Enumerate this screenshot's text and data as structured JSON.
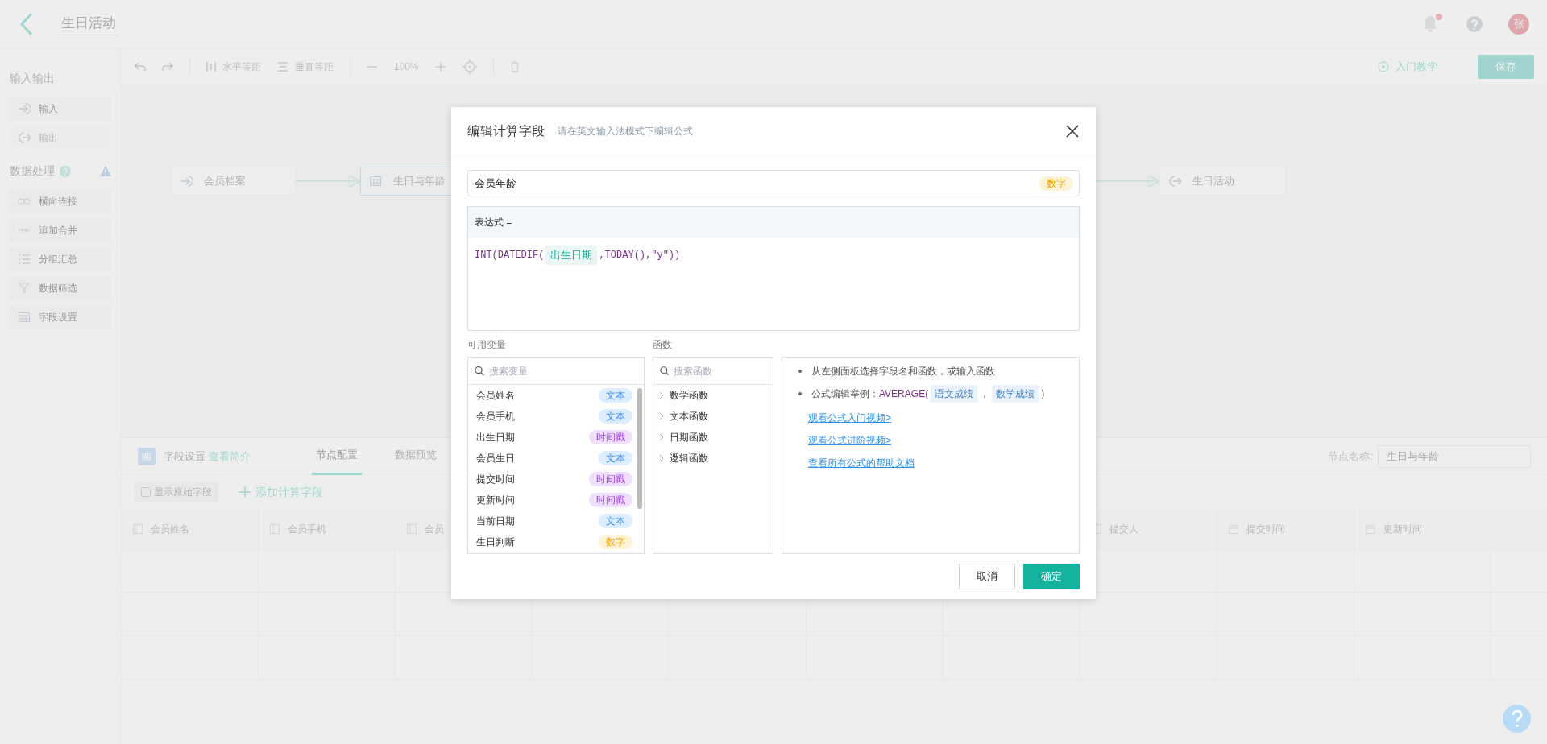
{
  "header": {
    "title": "生日活动",
    "has_notification": true,
    "avatar": "张"
  },
  "sidebar": {
    "sections": [
      {
        "title": "输入输出",
        "items": [
          {
            "label": "输入",
            "kind": "input",
            "disabled": false
          },
          {
            "label": "输出",
            "kind": "output",
            "disabled": true
          }
        ]
      },
      {
        "title": "数据处理",
        "help": true,
        "warning": true,
        "items": [
          {
            "label": "横向连接",
            "kind": "join",
            "disabled": false
          },
          {
            "label": "追加合并",
            "kind": "append",
            "disabled": false
          },
          {
            "label": "分组汇总",
            "kind": "group",
            "disabled": false
          },
          {
            "label": "数据筛选",
            "kind": "filter",
            "disabled": false
          },
          {
            "label": "字段设置",
            "kind": "fields",
            "disabled": false
          }
        ]
      }
    ]
  },
  "toolbar": {
    "h_distribute": "水平等距",
    "v_distribute": "垂直等距",
    "zoom": "100%",
    "tutorial": "入门教学",
    "save": "保存"
  },
  "canvas": {
    "nodes": [
      {
        "label": "会员档案",
        "kind": "input",
        "selected": false
      },
      {
        "label": "生日与年龄",
        "kind": "fields",
        "selected": true
      },
      {
        "label": "生日活动",
        "kind": "output",
        "selected": false
      }
    ]
  },
  "panel": {
    "title": "字段设置",
    "intro_link": "查看简介",
    "tabs": [
      {
        "label": "节点配置",
        "selected": true
      },
      {
        "label": "数据预览",
        "selected": false
      }
    ],
    "node_name_label": "节点名称:",
    "node_name": "生日与年龄",
    "show_original": "显示原始字段",
    "add_field": "添加计算字段",
    "table": {
      "columns_left": [
        {
          "label": "会员姓名",
          "kind": "text"
        },
        {
          "label": "会员手机",
          "kind": "text"
        },
        {
          "label": "会员",
          "kind": "text"
        }
      ],
      "columns_right": [
        {
          "label": "提交人",
          "kind": "text"
        },
        {
          "label": "提交时间",
          "kind": "date"
        },
        {
          "label": "更新时间",
          "kind": "date"
        }
      ]
    }
  },
  "modal": {
    "title": "编辑计算字段",
    "hint": "请在英文输入法模式下编辑公式",
    "field_name": "会员年龄",
    "field_type": {
      "label": "数字",
      "kind": "number"
    },
    "expression_label": "表达式 =",
    "expression": [
      {
        "kind": "code",
        "text": "INT(DATEDIF("
      },
      {
        "kind": "field",
        "text": "出生日期"
      },
      {
        "kind": "code",
        "text": ",TODAY(),\"y\"))"
      }
    ],
    "variables_label": "可用变量",
    "variables_search": {
      "placeholder": "搜索变量"
    },
    "variables": [
      {
        "name": "会员姓名",
        "type": {
          "label": "文本",
          "kind": "text"
        }
      },
      {
        "name": "会员手机",
        "type": {
          "label": "文本",
          "kind": "text"
        }
      },
      {
        "name": "出生日期",
        "type": {
          "label": "时间戳",
          "kind": "timestamp"
        }
      },
      {
        "name": "会员生日",
        "type": {
          "label": "文本",
          "kind": "text"
        }
      },
      {
        "name": "提交时间",
        "type": {
          "label": "时间戳",
          "kind": "timestamp"
        }
      },
      {
        "name": "更新时间",
        "type": {
          "label": "时间戳",
          "kind": "timestamp"
        }
      },
      {
        "name": "当前日期",
        "type": {
          "label": "文本",
          "kind": "text"
        }
      },
      {
        "name": "生日判断",
        "type": {
          "label": "数字",
          "kind": "number"
        }
      }
    ],
    "functions_label": "函数",
    "functions_search": {
      "placeholder": "搜索函数"
    },
    "functions": [
      {
        "label": "数学函数",
        "expanded": false
      },
      {
        "label": "文本函数",
        "expanded": false
      },
      {
        "label": "日期函数",
        "expanded": false
      },
      {
        "label": "逻辑函数",
        "expanded": false
      }
    ],
    "help": {
      "bullets": [
        [
          {
            "kind": "text",
            "text": "从左侧面板选择字段名和函数，或输入函数"
          }
        ],
        [
          {
            "kind": "text",
            "text": "公式编辑举例："
          },
          {
            "kind": "code",
            "text": "AVERAGE("
          },
          {
            "kind": "field",
            "text": "语文成绩"
          },
          {
            "kind": "text",
            "text": "，"
          },
          {
            "kind": "field",
            "text": "数学成绩"
          },
          {
            "kind": "text",
            "text": ")"
          }
        ]
      ],
      "links": [
        "观看公式入门视频>",
        "观看公式进阶视频>",
        "查看所有公式的帮助文档"
      ]
    },
    "cancel": "取消",
    "ok": "确定"
  }
}
